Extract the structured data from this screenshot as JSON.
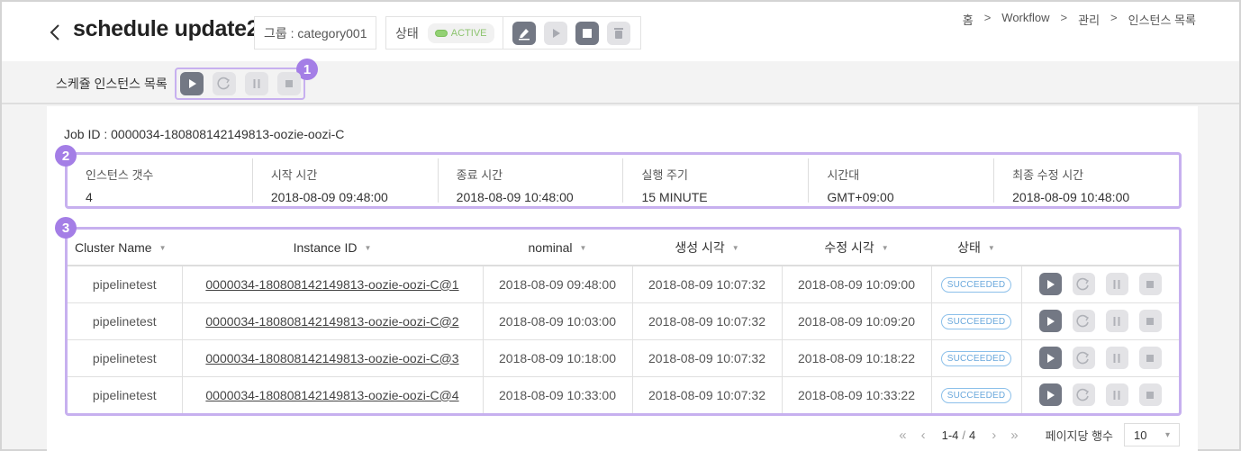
{
  "header": {
    "title": "schedule update2",
    "group_label": "그룹 : category001",
    "status_label": "상태",
    "status_value": "ACTIVE",
    "actions": [
      {
        "name": "edit",
        "icon": "pencil-icon",
        "state": "enabled"
      },
      {
        "name": "run",
        "icon": "play-icon",
        "state": "disabled"
      },
      {
        "name": "stop",
        "icon": "stop-icon",
        "state": "enabled"
      },
      {
        "name": "delete",
        "icon": "trash-icon",
        "state": "disabled"
      }
    ]
  },
  "breadcrumb": [
    "홈",
    "Workflow",
    "관리",
    "인스턴스 목록"
  ],
  "toolbar": {
    "label": "스케쥴 인스턴스 목록",
    "annotation": "1",
    "actions": [
      {
        "name": "run",
        "icon": "play-icon",
        "state": "enabled"
      },
      {
        "name": "rerun",
        "icon": "refresh-icon",
        "state": "disabled"
      },
      {
        "name": "pause",
        "icon": "pause-icon",
        "state": "disabled"
      },
      {
        "name": "stop",
        "icon": "stop-icon",
        "state": "disabled"
      }
    ]
  },
  "job": {
    "id_label": "Job ID : 0000034-180808142149813-oozie-oozi-C",
    "annotation": "2",
    "info": [
      {
        "label": "인스턴스 갯수",
        "value": "4"
      },
      {
        "label": "시작 시간",
        "value": "2018-08-09 09:48:00"
      },
      {
        "label": "종료 시간",
        "value": "2018-08-09 10:48:00"
      },
      {
        "label": "실행 주기",
        "value": "15 MINUTE"
      },
      {
        "label": "시간대",
        "value": "GMT+09:00"
      },
      {
        "label": "최종 수정 시간",
        "value": "2018-08-09 10:48:00"
      }
    ]
  },
  "table": {
    "annotation": "3",
    "columns": [
      "Cluster Name",
      "Instance ID",
      "nominal",
      "생성 시각",
      "수정 시각",
      "상태"
    ],
    "rows": [
      {
        "cluster": "pipelinetest",
        "instance_id": "0000034-180808142149813-oozie-oozi-C@1",
        "nominal": "2018-08-09 09:48:00",
        "created": "2018-08-09 10:07:32",
        "modified": "2018-08-09 10:09:00",
        "status": "SUCCEEDED"
      },
      {
        "cluster": "pipelinetest",
        "instance_id": "0000034-180808142149813-oozie-oozi-C@2",
        "nominal": "2018-08-09 10:03:00",
        "created": "2018-08-09 10:07:32",
        "modified": "2018-08-09 10:09:20",
        "status": "SUCCEEDED"
      },
      {
        "cluster": "pipelinetest",
        "instance_id": "0000034-180808142149813-oozie-oozi-C@3",
        "nominal": "2018-08-09 10:18:00",
        "created": "2018-08-09 10:07:32",
        "modified": "2018-08-09 10:18:22",
        "status": "SUCCEEDED"
      },
      {
        "cluster": "pipelinetest",
        "instance_id": "0000034-180808142149813-oozie-oozi-C@4",
        "nominal": "2018-08-09 10:33:00",
        "created": "2018-08-09 10:07:32",
        "modified": "2018-08-09 10:33:22",
        "status": "SUCCEEDED"
      }
    ]
  },
  "pagination": {
    "range": "1-4",
    "total": "4",
    "rows_per_page_label": "페이지당 행수",
    "rows_per_page": "10"
  },
  "colors": {
    "accent_annotation": "#a47ee6",
    "annotation_border": "#c7b0ef",
    "active_green": "#93d174",
    "succeeded_blue": "#6aa8dc",
    "button_dark": "#737884",
    "button_light": "#e3e3e6"
  }
}
